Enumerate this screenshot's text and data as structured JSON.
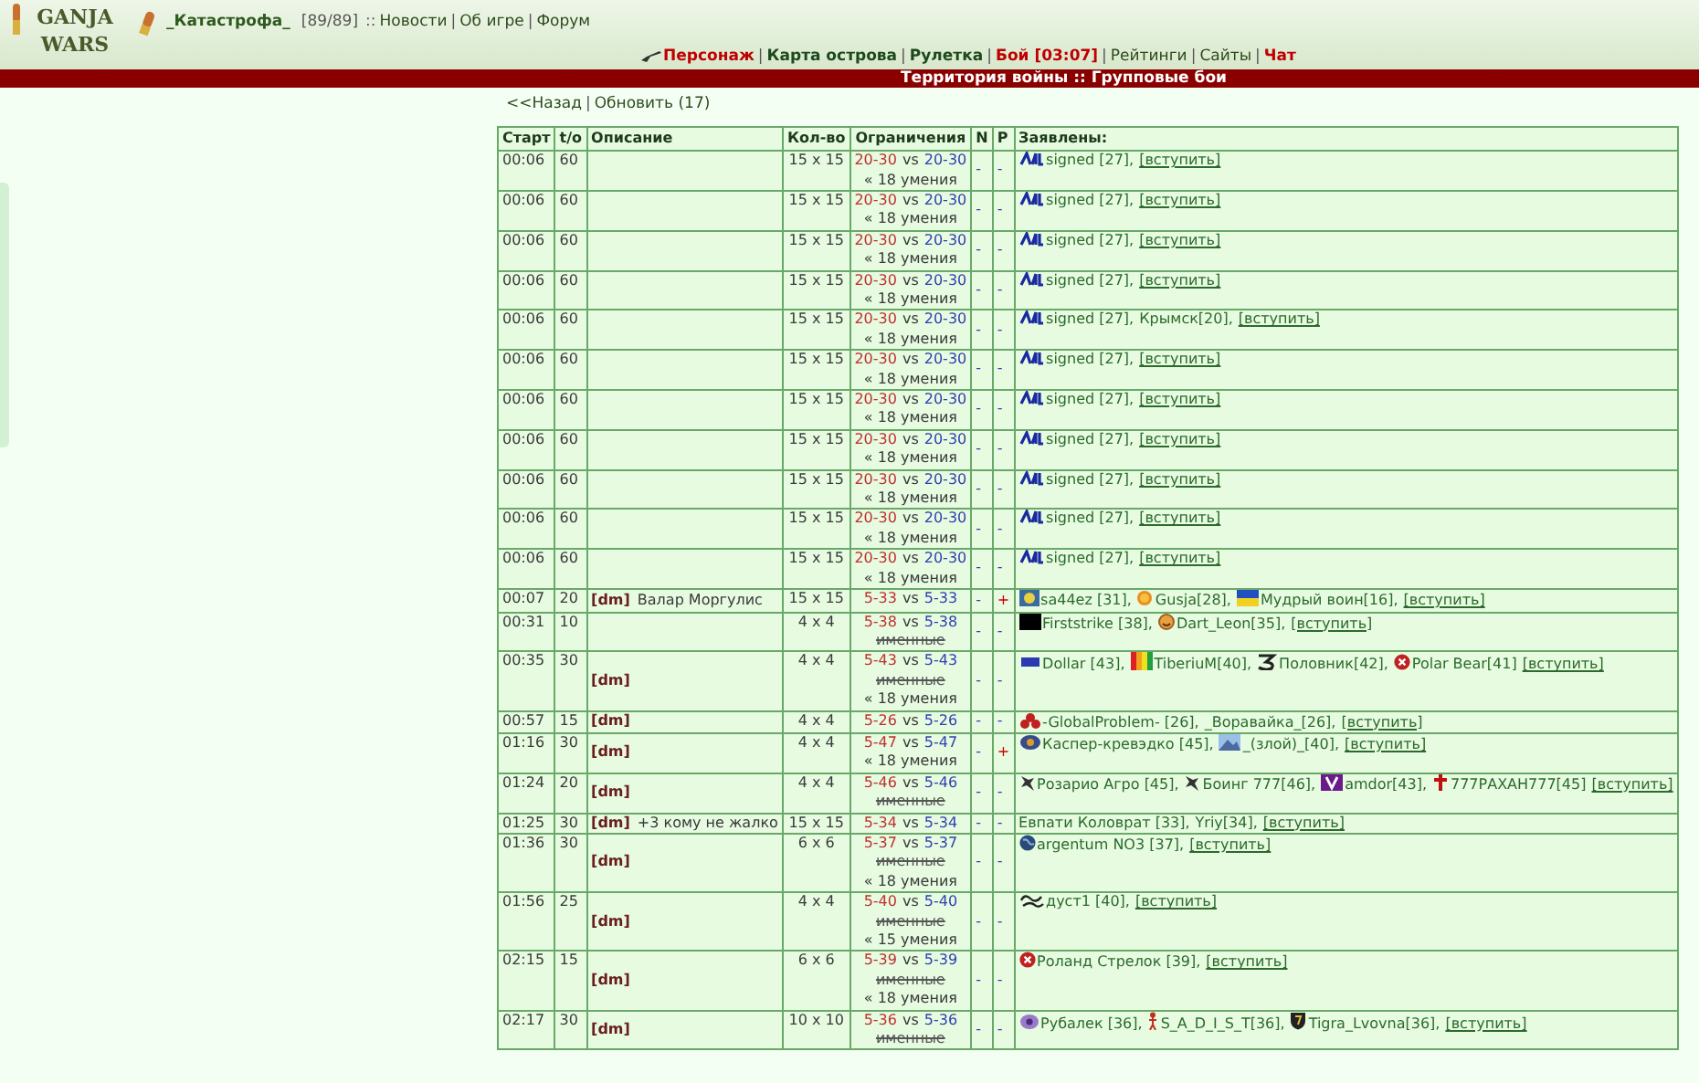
{
  "header": {
    "logo": {
      "top": "GANJA",
      "bottom": "WARS"
    },
    "user": "_Катастрофа_",
    "hp": "[89/89]",
    "sep": "::",
    "top_links": [
      {
        "label": "Новости",
        "sep": "|"
      },
      {
        "label": "Об игре",
        "sep": "|"
      },
      {
        "label": "Форум"
      }
    ],
    "nav": [
      {
        "label": "Персонаж",
        "kind": "red",
        "sep": "|"
      },
      {
        "label": "Карта острова",
        "kind": "bold",
        "sep": "|"
      },
      {
        "label": "Рулетка",
        "kind": "bold",
        "sep": "|"
      },
      {
        "label": "Бой [03:07]",
        "kind": "red",
        "sep": "|"
      },
      {
        "label": "Рейтинги",
        "kind": "plain",
        "sep": "|"
      },
      {
        "label": "Сайты",
        "kind": "plain",
        "sep": "|"
      },
      {
        "label": "Чат",
        "kind": "red"
      }
    ]
  },
  "title_bar": "Территория войны :: Групповые бои",
  "actions": [
    {
      "label": "<<Назад",
      "sep": "|"
    },
    {
      "label": "Обновить (17)"
    }
  ],
  "table": {
    "columns": [
      "Старт",
      "t/o",
      "Описание",
      "Кол-во",
      "Ограничения",
      "N",
      "P",
      "Заявлены:"
    ],
    "rows": [
      {
        "start": "00:06",
        "timeout": "60",
        "size": "15 x 15",
        "limits": {
          "left": "20-30",
          "vs": "vs",
          "right": "20-30",
          "skills": "« 18 умения"
        },
        "n": "-",
        "p": "-",
        "players": [
          {
            "kind": "clan",
            "text": "signed [27],"
          }
        ],
        "join": "[вступить]"
      },
      {
        "start": "00:06",
        "timeout": "60",
        "size": "15 x 15",
        "limits": {
          "left": "20-30",
          "vs": "vs",
          "right": "20-30",
          "skills": "« 18 умения"
        },
        "n": "-",
        "p": "-",
        "players": [
          {
            "kind": "clan",
            "text": "signed [27],"
          }
        ],
        "join": "[вступить]"
      },
      {
        "start": "00:06",
        "timeout": "60",
        "size": "15 x 15",
        "limits": {
          "left": "20-30",
          "vs": "vs",
          "right": "20-30",
          "skills": "« 18 умения"
        },
        "n": "-",
        "p": "-",
        "players": [
          {
            "kind": "clan",
            "text": "signed [27],"
          }
        ],
        "join": "[вступить]"
      },
      {
        "start": "00:06",
        "timeout": "60",
        "size": "15 x 15",
        "limits": {
          "left": "20-30",
          "vs": "vs",
          "right": "20-30",
          "skills": "« 18 умения"
        },
        "n": "-",
        "p": "-",
        "players": [
          {
            "kind": "clan",
            "text": "signed [27],"
          }
        ],
        "join": "[вступить]"
      },
      {
        "start": "00:06",
        "timeout": "60",
        "size": "15 x 15",
        "limits": {
          "left": "20-30",
          "vs": "vs",
          "right": "20-30",
          "skills": "« 18 умения"
        },
        "n": "-",
        "p": "-",
        "players": [
          {
            "kind": "clan",
            "text": "signed [27],"
          },
          {
            "kind": "plain",
            "text": "Крымск[20],"
          }
        ],
        "join": "[вступить]"
      },
      {
        "start": "00:06",
        "timeout": "60",
        "size": "15 x 15",
        "limits": {
          "left": "20-30",
          "vs": "vs",
          "right": "20-30",
          "skills": "« 18 умения"
        },
        "n": "-",
        "p": "-",
        "players": [
          {
            "kind": "clan",
            "text": "signed [27],"
          }
        ],
        "join": "[вступить]"
      },
      {
        "start": "00:06",
        "timeout": "60",
        "size": "15 x 15",
        "limits": {
          "left": "20-30",
          "vs": "vs",
          "right": "20-30",
          "skills": "« 18 умения"
        },
        "n": "-",
        "p": "-",
        "players": [
          {
            "kind": "clan",
            "text": "signed [27],"
          }
        ],
        "join": "[вступить]"
      },
      {
        "start": "00:06",
        "timeout": "60",
        "size": "15 x 15",
        "limits": {
          "left": "20-30",
          "vs": "vs",
          "right": "20-30",
          "skills": "« 18 умения"
        },
        "n": "-",
        "p": "-",
        "players": [
          {
            "kind": "clan",
            "text": "signed [27],"
          }
        ],
        "join": "[вступить]"
      },
      {
        "start": "00:06",
        "timeout": "60",
        "size": "15 x 15",
        "limits": {
          "left": "20-30",
          "vs": "vs",
          "right": "20-30",
          "skills": "« 18 умения"
        },
        "n": "-",
        "p": "-",
        "players": [
          {
            "kind": "clan",
            "text": "signed [27],"
          }
        ],
        "join": "[вступить]"
      },
      {
        "start": "00:06",
        "timeout": "60",
        "size": "15 x 15",
        "limits": {
          "left": "20-30",
          "vs": "vs",
          "right": "20-30",
          "skills": "« 18 умения"
        },
        "n": "-",
        "p": "-",
        "players": [
          {
            "kind": "clan",
            "text": "signed [27],"
          }
        ],
        "join": "[вступить]"
      },
      {
        "start": "00:06",
        "timeout": "60",
        "size": "15 x 15",
        "limits": {
          "left": "20-30",
          "vs": "vs",
          "right": "20-30",
          "skills": "« 18 умения"
        },
        "n": "-",
        "p": "-",
        "players": [
          {
            "kind": "clan",
            "text": "signed [27],"
          }
        ],
        "join": "[вступить]"
      },
      {
        "start": "00:07",
        "timeout": "20",
        "dm": "[dm]",
        "description": "Валар Моргулис",
        "size": "15 x 15",
        "limits": {
          "left": "5-33",
          "vs": "vs",
          "right": "5-33"
        },
        "n": "-",
        "p": "+",
        "players": [
          {
            "kind": "badge",
            "text": "sa44ez [31],"
          },
          {
            "kind": "sun",
            "text": "Gusja[28],"
          },
          {
            "kind": "flag",
            "text": "Мудрый воин[16],"
          }
        ],
        "join": "[вступить]"
      },
      {
        "start": "00:31",
        "timeout": "10",
        "size": "4 x 4",
        "limits": {
          "left": "5-38",
          "vs": "vs",
          "right": "5-38",
          "named": "именные"
        },
        "n": "-",
        "p": "-",
        "players": [
          {
            "kind": "square",
            "text": "Firststrike [38],"
          },
          {
            "kind": "smiley",
            "text": "Dart_Leon[35],"
          }
        ],
        "join": "[вступить]"
      },
      {
        "start": "00:35",
        "timeout": "30",
        "dm": "[dm]",
        "size": "4 x 4",
        "limits": {
          "left": "5-43",
          "vs": "vs",
          "right": "5-43",
          "named": "именные",
          "skills": "« 18 умения"
        },
        "n": "-",
        "p": "-",
        "players": [
          {
            "kind": "digits",
            "text": "Dollar [43],"
          },
          {
            "kind": "rainbow",
            "text": "TiberiuM[40],"
          },
          {
            "kind": "glyph",
            "text": "Половник[42],"
          },
          {
            "kind": "redx",
            "text": "Polar Bear[41]"
          }
        ],
        "join": "[вступить]"
      },
      {
        "start": "00:57",
        "timeout": "15",
        "dm": "[dm]",
        "size": "4 x 4",
        "limits": {
          "left": "5-26",
          "vs": "vs",
          "right": "5-26"
        },
        "n": "-",
        "p": "-",
        "players": [
          {
            "kind": "biohazard",
            "text": "-GlobalProblem- [26],"
          },
          {
            "kind": "plain",
            "text": "_Воравайка_[26],"
          }
        ],
        "join": "[вступить]"
      },
      {
        "start": "01:16",
        "timeout": "30",
        "dm": "[dm]",
        "size": "4 x 4",
        "limits": {
          "left": "5-47",
          "vs": "vs",
          "right": "5-47",
          "skills": "« 18 умения"
        },
        "n": "-",
        "p": "+",
        "players": [
          {
            "kind": "eye",
            "text": "Каспер-кревэдко [45],"
          },
          {
            "kind": "mountain",
            "text": "_(злой)_[40],"
          }
        ],
        "join": "[вступить]"
      },
      {
        "start": "01:24",
        "timeout": "20",
        "dm": "[dm]",
        "size": "4 x 4",
        "limits": {
          "left": "5-46",
          "vs": "vs",
          "right": "5-46",
          "named": "именные"
        },
        "n": "-",
        "p": "-",
        "players": [
          {
            "kind": "bird",
            "text": "Розарио Агро [45],"
          },
          {
            "kind": "bird",
            "text": "Боинг 777[46],"
          },
          {
            "kind": "letter",
            "text": "amdor[43],"
          },
          {
            "kind": "cross",
            "text": "777РАХАН777[45]"
          }
        ],
        "join": "[вступить]"
      },
      {
        "start": "01:25",
        "timeout": "30",
        "dm": "[dm]",
        "description": "+3 кому не жалко",
        "size": "15 x 15",
        "limits": {
          "left": "5-34",
          "vs": "vs",
          "right": "5-34"
        },
        "n": "-",
        "p": "-",
        "players": [
          {
            "kind": "plain",
            "text": "Евпати Коловрат [33],"
          },
          {
            "kind": "plain",
            "text": "Yriy[34],"
          }
        ],
        "join": "[вступить]"
      },
      {
        "start": "01:36",
        "timeout": "30",
        "dm": "[dm]",
        "size": "6 x 6",
        "limits": {
          "left": "5-37",
          "vs": "vs",
          "right": "5-37",
          "named": "именные",
          "skills": "« 18 умения"
        },
        "n": "-",
        "p": "-",
        "players": [
          {
            "kind": "globe",
            "text": "argentum NO3 [37],"
          }
        ],
        "join": "[вступить]"
      },
      {
        "start": "01:56",
        "timeout": "25",
        "dm": "[dm]",
        "size": "4 x 4",
        "limits": {
          "left": "5-40",
          "vs": "vs",
          "right": "5-40",
          "named": "именные",
          "skills": "« 15 умения"
        },
        "n": "-",
        "p": "-",
        "players": [
          {
            "kind": "swirl",
            "text": "дуст1 [40],"
          }
        ],
        "join": "[вступить]"
      },
      {
        "start": "02:15",
        "timeout": "15",
        "dm": "[dm]",
        "size": "6 x 6",
        "limits": {
          "left": "5-39",
          "vs": "vs",
          "right": "5-39",
          "named": "именные",
          "skills": "« 18 умения"
        },
        "n": "-",
        "p": "-",
        "players": [
          {
            "kind": "redx",
            "text": "Роланд Стрелок [39],"
          }
        ],
        "join": "[вступить]"
      },
      {
        "start": "02:17",
        "timeout": "30",
        "dm": "[dm]",
        "size": "10 x 10",
        "limits": {
          "left": "5-36",
          "vs": "vs",
          "right": "5-36",
          "named": "именные"
        },
        "n": "-",
        "p": "-",
        "players": [
          {
            "kind": "purpleeye",
            "text": "Рубалек [36],"
          },
          {
            "kind": "figure",
            "text": "S_A_D_I_S_T[36],"
          },
          {
            "kind": "shield",
            "text": "Tigra_Lvovna[36],"
          }
        ],
        "join": "[вступить]"
      }
    ]
  }
}
